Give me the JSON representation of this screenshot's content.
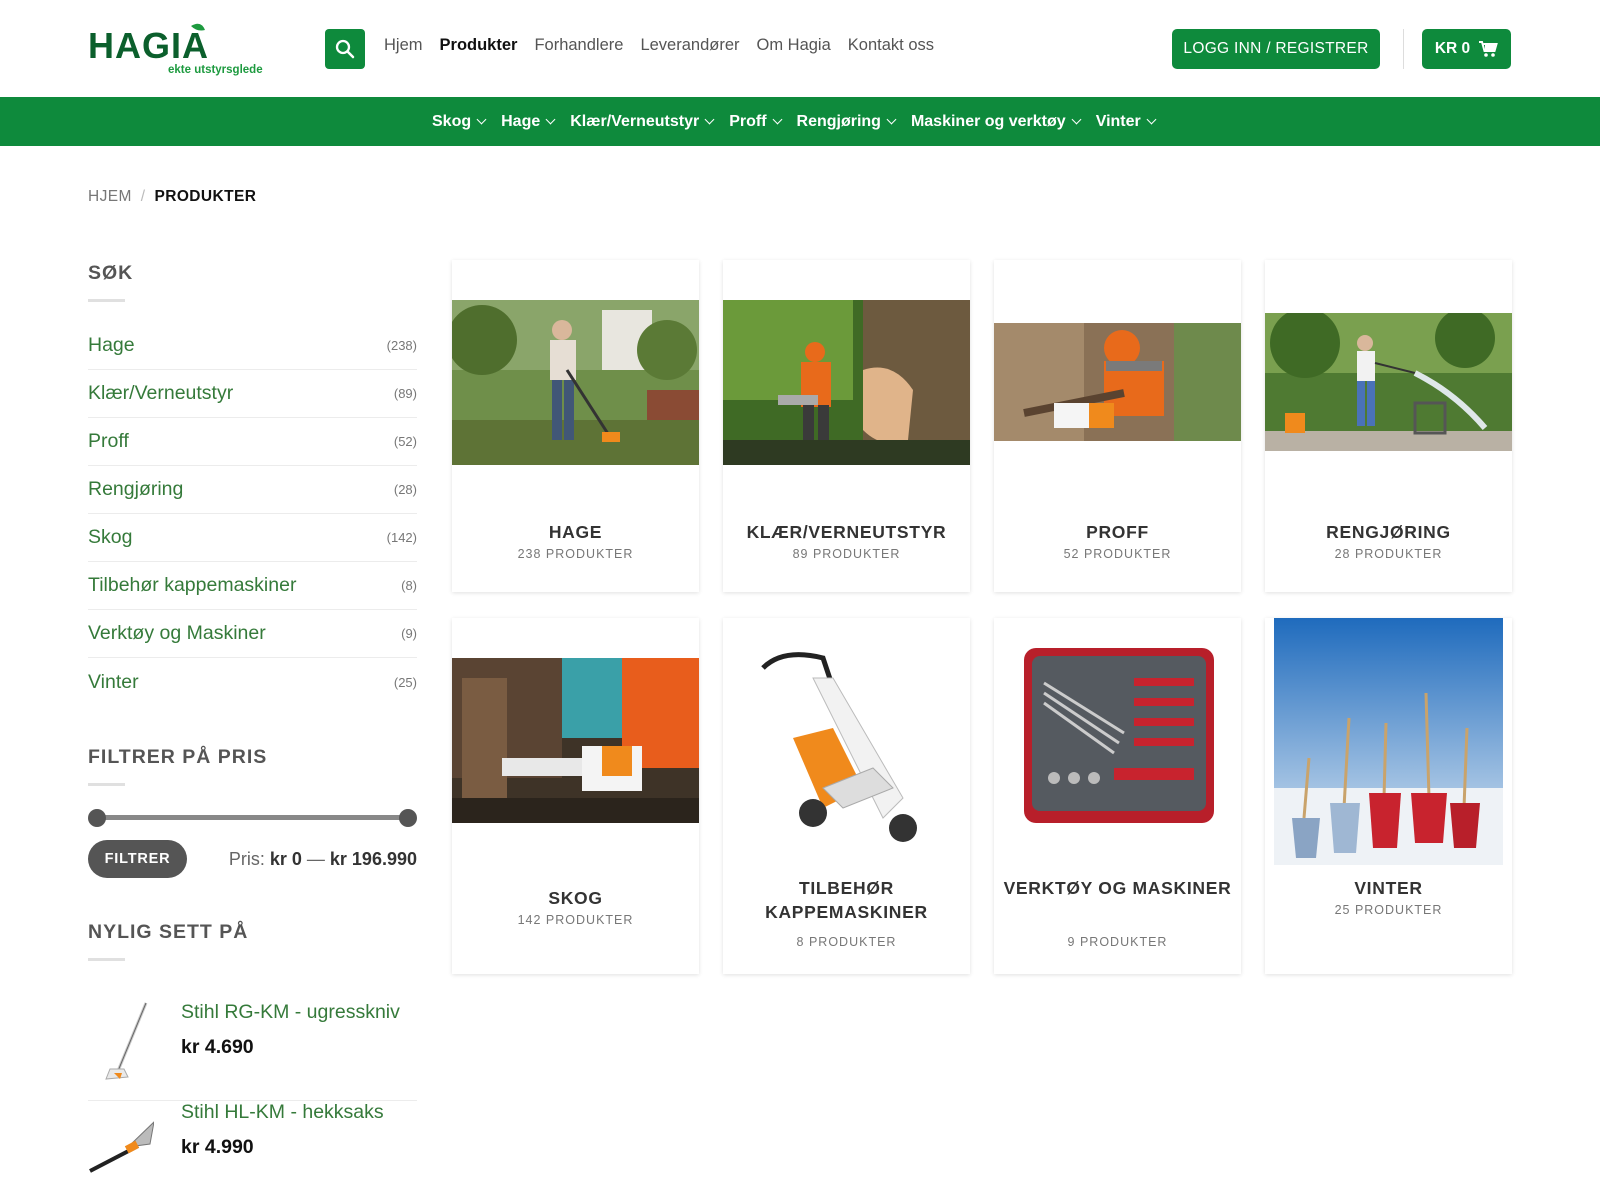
{
  "header": {
    "logo_text": "HAGIA",
    "logo_tagline": "ekte utstyrsglede",
    "nav": [
      "Hjem",
      "Produkter",
      "Forhandlere",
      "Leverandører",
      "Om Hagia",
      "Kontakt oss"
    ],
    "active_nav": "Produkter",
    "login_label": "LOGG INN / REGISTRER",
    "cart_label": "KR 0"
  },
  "category_nav": [
    "Skog",
    "Hage",
    "Klær/Verneutstyr",
    "Proff",
    "Rengjøring",
    "Maskiner og verktøy",
    "Vinter"
  ],
  "breadcrumb": {
    "home": "HJEM",
    "separator": "/",
    "current": "PRODUKTER"
  },
  "sidebar": {
    "search_title": "SØK",
    "categories": [
      {
        "label": "Hage",
        "count": "(238)"
      },
      {
        "label": "Klær/Verneutstyr",
        "count": "(89)"
      },
      {
        "label": "Proff",
        "count": "(52)"
      },
      {
        "label": "Rengjøring",
        "count": "(28)"
      },
      {
        "label": "Skog",
        "count": "(142)"
      },
      {
        "label": "Tilbehør kappemaskiner",
        "count": "(8)"
      },
      {
        "label": "Verktøy og Maskiner",
        "count": "(9)"
      },
      {
        "label": "Vinter",
        "count": "(25)"
      }
    ],
    "price_title": "FILTRER PÅ PRIS",
    "filter_label": "FILTRER",
    "price_prefix": "Pris:",
    "price_min": "kr 0",
    "price_dash": "—",
    "price_max": "kr 196.990",
    "recent_title": "NYLIG SETT PÅ",
    "recent": [
      {
        "name": "Stihl RG-KM - ugresskniv",
        "price": "kr 4.690"
      },
      {
        "name": "Stihl HL-KM - hekksaks",
        "price": "kr 4.990"
      }
    ]
  },
  "products": [
    {
      "title": "HAGE",
      "count": "238 PRODUKTER"
    },
    {
      "title": "KLÆR/VERNEUTSTYR",
      "count": "89 PRODUKTER"
    },
    {
      "title": "PROFF",
      "count": "52 PRODUKTER"
    },
    {
      "title": "RENGJØRING",
      "count": "28 PRODUKTER"
    },
    {
      "title": "SKOG",
      "count": "142 PRODUKTER"
    },
    {
      "title": "TILBEHØR KAPPEMASKINER",
      "count": "8 PRODUKTER"
    },
    {
      "title": "VERKTØY OG MASKINER",
      "count": "9 PRODUKTER"
    },
    {
      "title": "VINTER",
      "count": "25 PRODUKTER"
    }
  ],
  "colors": {
    "brand_green": "#0e8a3c",
    "link_green": "#357a3a"
  }
}
